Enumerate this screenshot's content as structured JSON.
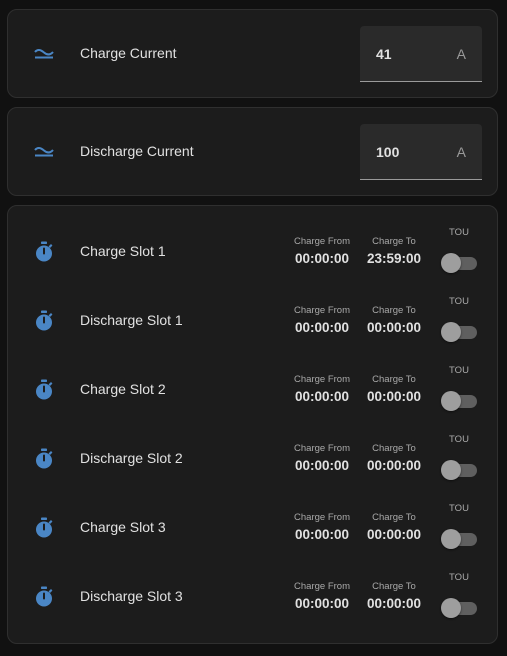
{
  "accent_color": "#4a86c5",
  "number_entities": [
    {
      "label": "Charge Current",
      "value": "41",
      "unit": "A",
      "icon": "current-ac-icon"
    },
    {
      "label": "Discharge Current",
      "value": "100",
      "unit": "A",
      "icon": "current-ac-icon"
    }
  ],
  "slots": [
    {
      "label": "Charge Slot 1",
      "from_label": "Charge From",
      "from": "00:00:00",
      "to_label": "Charge To",
      "to": "23:59:00",
      "tou_label": "TOU",
      "tou_on": false,
      "icon": "timer-icon"
    },
    {
      "label": "Discharge Slot 1",
      "from_label": "Charge From",
      "from": "00:00:00",
      "to_label": "Charge To",
      "to": "00:00:00",
      "tou_label": "TOU",
      "tou_on": false,
      "icon": "timer-icon"
    },
    {
      "label": "Charge Slot 2",
      "from_label": "Charge From",
      "from": "00:00:00",
      "to_label": "Charge To",
      "to": "00:00:00",
      "tou_label": "TOU",
      "tou_on": false,
      "icon": "timer-icon"
    },
    {
      "label": "Discharge Slot 2",
      "from_label": "Charge From",
      "from": "00:00:00",
      "to_label": "Charge To",
      "to": "00:00:00",
      "tou_label": "TOU",
      "tou_on": false,
      "icon": "timer-icon"
    },
    {
      "label": "Charge Slot 3",
      "from_label": "Charge From",
      "from": "00:00:00",
      "to_label": "Charge To",
      "to": "00:00:00",
      "tou_label": "TOU",
      "tou_on": false,
      "icon": "timer-icon"
    },
    {
      "label": "Discharge Slot 3",
      "from_label": "Charge From",
      "from": "00:00:00",
      "to_label": "Charge To",
      "to": "00:00:00",
      "tou_label": "TOU",
      "tou_on": false,
      "icon": "timer-icon"
    }
  ]
}
